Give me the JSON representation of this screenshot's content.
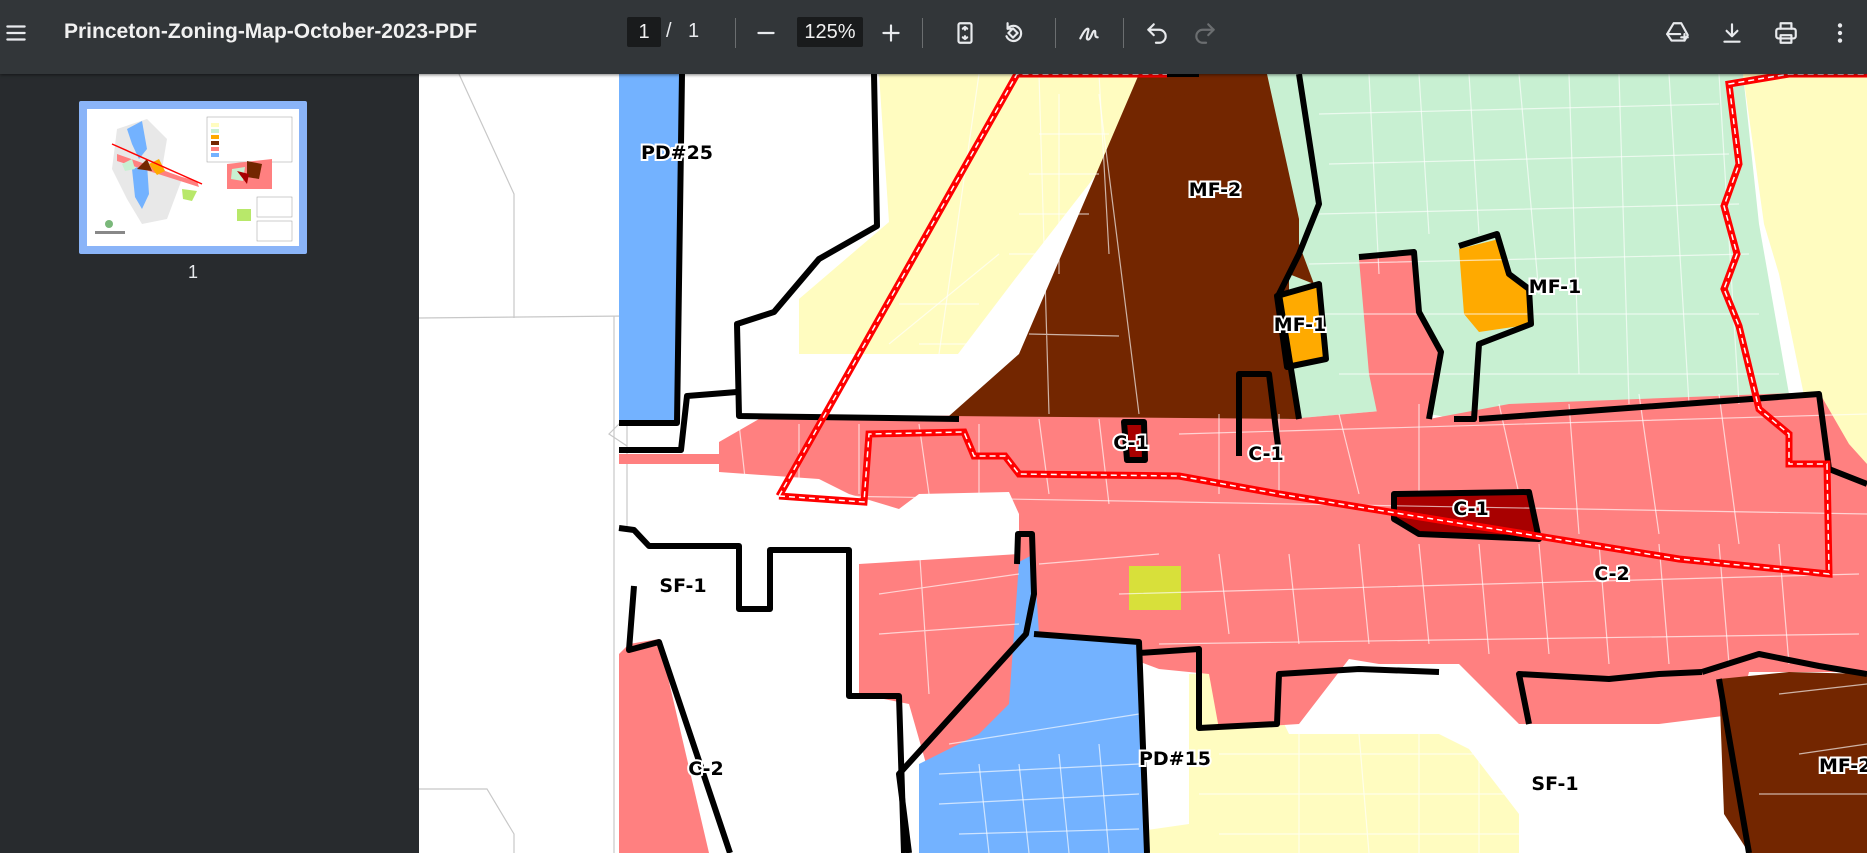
{
  "viewer": {
    "title": "Princeton-Zoning-Map-October-2023-PDF",
    "current_page": "1",
    "page_separator": "/",
    "total_pages": "1",
    "zoom": "125%"
  },
  "icons": {
    "menu": "menu-icon",
    "zoom_out": "minus-icon",
    "zoom_in": "plus-icon",
    "fit": "fit-to-page-icon",
    "rotate": "rotate-icon",
    "annotate": "draw-icon",
    "undo": "undo-icon",
    "redo": "redo-icon",
    "drive": "add-to-drive-icon",
    "download": "download-icon",
    "print": "print-icon",
    "more": "more-vert-icon"
  },
  "sidebar": {
    "thumbnail_label": "1"
  },
  "map": {
    "labels": {
      "pd25": "PD#25",
      "mf2_top": "MF-2",
      "mf1_left": "MF-1",
      "mf1_right": "MF-1",
      "c1_a": "C-1",
      "c1_b": "C-1",
      "c1_c": "C-1",
      "c2_main": "C-2",
      "sf1_left": "SF-1",
      "c2_bottom": "C-2",
      "pd15": "PD#15",
      "sf1_bottom": "SF-1",
      "mf2_right": "MF-2"
    }
  },
  "colors": {
    "toolbar_bg": "#323639",
    "sidebar_bg": "#282b2e",
    "thumb_border": "#8ab4f8",
    "commercial_c2": "#ff8080",
    "commercial_c1": "#a80000",
    "multifamily_mf2": "#732600",
    "multifamily_mf1": "#ffaa00",
    "single_family": "#fffcc0",
    "planned_dev": "#73b2ff",
    "residential_green": "#c8f0d2",
    "district_boundary": "#ff0000"
  }
}
